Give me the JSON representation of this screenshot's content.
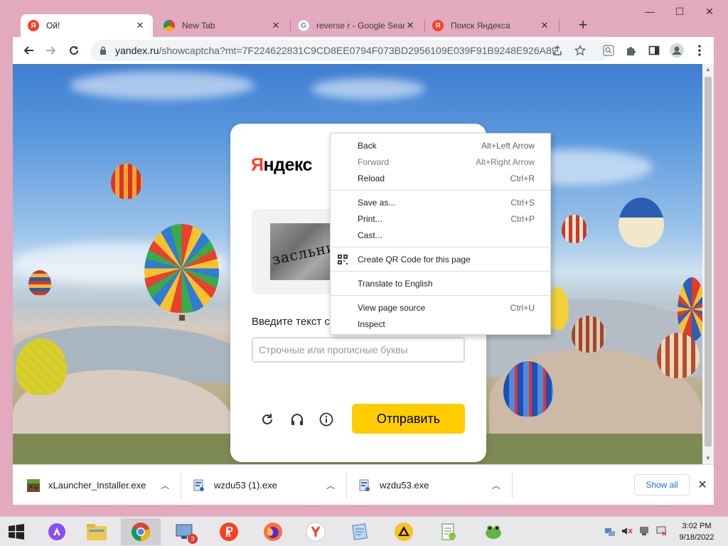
{
  "browser": {
    "tabs": [
      {
        "title": "Ой!",
        "active": true,
        "favicon": "yandex-favicon"
      },
      {
        "title": "New Tab",
        "active": false,
        "favicon": "chrome-favicon"
      },
      {
        "title": "reverse r - Google Sear",
        "active": false,
        "favicon": "google-favicon"
      },
      {
        "title": "Поиск Яндекса",
        "active": false,
        "favicon": "yandex-favicon"
      }
    ],
    "new_tab": "+",
    "url_main": "yandex.ru",
    "url_rest": "/showcaptcha?mt=7F224622831C9CD8EE0794F073BD2956109E039F91B9248E926A89...",
    "window_controls": {
      "minimize": "—",
      "maximize": "☐",
      "close": "✕"
    }
  },
  "captcha": {
    "logo_ya": "Я",
    "logo_rest": "ндекс",
    "captcha_text": "засльни",
    "prompt": "Введите текст с картинки",
    "input_placeholder": "Строчные или прописные буквы",
    "submit_label": "Отправить"
  },
  "context_menu": {
    "items": [
      {
        "label": "Back",
        "shortcut": "Alt+Left Arrow"
      },
      {
        "label": "Forward",
        "shortcut": "Alt+Right Arrow",
        "disabled": true
      },
      {
        "label": "Reload",
        "shortcut": "Ctrl+R"
      },
      {
        "label": "Save as...",
        "shortcut": "Ctrl+S"
      },
      {
        "label": "Print...",
        "shortcut": "Ctrl+P"
      },
      {
        "label": "Cast...",
        "shortcut": ""
      },
      {
        "label": "Create QR Code for this page",
        "shortcut": ""
      },
      {
        "label": "Translate to English",
        "shortcut": ""
      },
      {
        "label": "View page source",
        "shortcut": "Ctrl+U"
      },
      {
        "label": "Inspect",
        "shortcut": ""
      }
    ]
  },
  "downloads": {
    "items": [
      {
        "name": "xLauncher_Installer.exe"
      },
      {
        "name": "wzdu53 (1).exe"
      },
      {
        "name": "wzdu53.exe"
      }
    ],
    "show_all": "Show all",
    "close": "✕"
  },
  "taskbar": {
    "time": "3:02 PM",
    "date": "9/18/2022",
    "badge_count": "3"
  },
  "colors": {
    "frame": "#e2a9bf",
    "yandex_red": "#fc3f1d",
    "submit_yellow": "#ffcc00"
  }
}
